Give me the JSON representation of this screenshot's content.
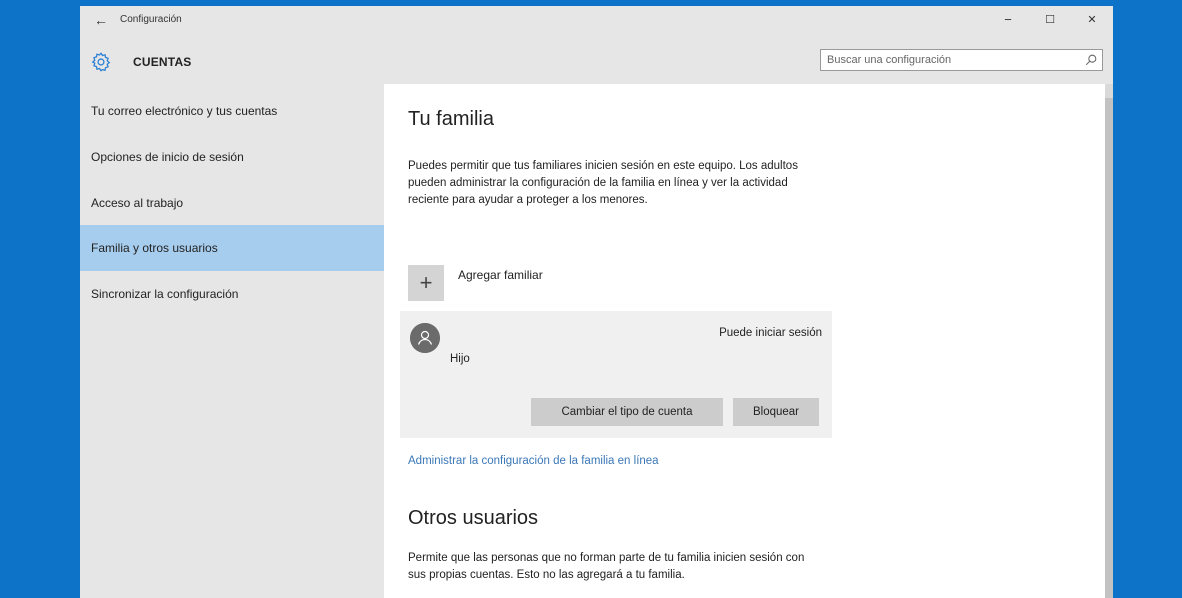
{
  "window": {
    "back_glyph": "←",
    "title": "Configuración",
    "minimize_glyph": "−",
    "maximize_glyph": "☐",
    "close_glyph": "✕"
  },
  "header": {
    "section_title": "CUENTAS",
    "search_placeholder": "Buscar una configuración"
  },
  "sidebar": {
    "items": [
      {
        "label": "Tu correo electrónico y tus cuentas",
        "active": false
      },
      {
        "label": "Opciones de inicio de sesión",
        "active": false
      },
      {
        "label": "Acceso al trabajo",
        "active": false
      },
      {
        "label": "Familia y otros usuarios",
        "active": true
      },
      {
        "label": "Sincronizar la configuración",
        "active": false
      }
    ]
  },
  "main": {
    "family_title": "Tu familia",
    "family_desc": "Puedes permitir que tus familiares inicien sesión en este equipo. Los adultos pueden administrar la configuración de la familia en línea y ver la actividad reciente para ayudar a proteger a los menores.",
    "add_glyph": "+",
    "add_label": "Agregar familiar",
    "member": {
      "status": "Puede iniciar sesión",
      "name": "Hijo",
      "change_type_label": "Cambiar el tipo de cuenta",
      "block_label": "Bloquear"
    },
    "manage_link": "Administrar la configuración de la familia en línea",
    "others_title": "Otros usuarios",
    "others_desc": "Permite que las personas que no forman parte de tu familia inicien sesión con sus propias cuentas. Esto no las agregará a tu familia."
  },
  "colors": {
    "desktop": "#0d73c8",
    "accent_selected": "#a7cdee",
    "link": "#3b78b7"
  },
  "icons": [
    "back-arrow-icon",
    "gear-icon",
    "search-icon",
    "plus-icon",
    "user-avatar-icon"
  ]
}
